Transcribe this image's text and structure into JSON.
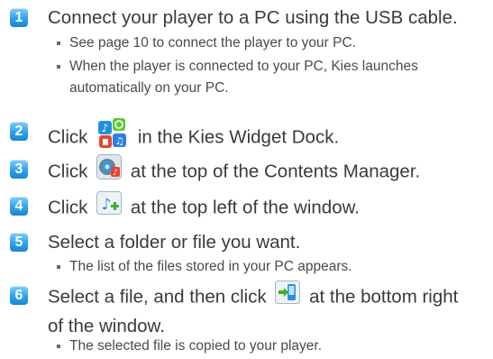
{
  "steps": [
    {
      "num": "1",
      "text": "Connect your player to a PC using the USB cable."
    },
    {
      "num": "2",
      "pre": "Click",
      "post": "in the Kies Widget Dock.",
      "icon": "kies-widget-dock-icon"
    },
    {
      "num": "3",
      "pre": "Click",
      "post": "at the top of the Contents Manager.",
      "icon": "contents-manager-music-icon"
    },
    {
      "num": "4",
      "pre": "Click",
      "post": "at the top left of the window.",
      "icon": "add-music-file-icon"
    },
    {
      "num": "5",
      "text": "Select a folder or file you want."
    },
    {
      "num": "6",
      "pre": "Select a file, and then click",
      "post": "at the bottom right",
      "line2": "of the window.",
      "icon": "transfer-to-player-icon"
    }
  ],
  "bullets": {
    "step1_a": "See page 10 to connect the player to your PC.",
    "step1_b_line1": "When the player is connected to your PC, Kies launches",
    "step1_b_line2": "automatically on your PC.",
    "step5_a": "The list of the files stored in your PC appears.",
    "step6_a": "The selected file is copied to your player."
  },
  "colors": {
    "badge": "#2ea2ea",
    "text": "#3a3a3a"
  }
}
